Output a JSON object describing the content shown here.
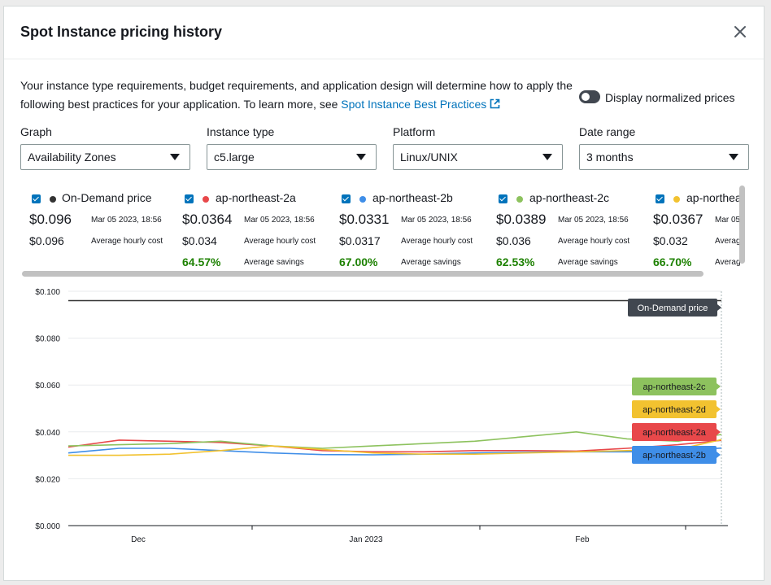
{
  "modal": {
    "title": "Spot Instance pricing history",
    "description": "Your instance type requirements, budget requirements, and application design will determine how to apply the following best practices for your application. To learn more, see ",
    "link_text": "Spot Instance Best Practices",
    "toggle_label": "Display normalized prices"
  },
  "filters": [
    {
      "label": "Graph",
      "value": "Availability Zones"
    },
    {
      "label": "Instance type",
      "value": "c5.large"
    },
    {
      "label": "Platform",
      "value": "Linux/UNIX"
    },
    {
      "label": "Date range",
      "value": "3 months"
    }
  ],
  "legend": [
    {
      "name": "On-Demand price",
      "color": "#333333",
      "price": "$0.096",
      "timestamp": "Mar 05 2023, 18:56",
      "avg_price": "$0.096",
      "avg_label": "Average hourly cost",
      "saving": "",
      "saving_label": ""
    },
    {
      "name": "ap-northeast-2a",
      "color": "#e8484a",
      "price": "$0.0364",
      "timestamp": "Mar 05 2023, 18:56",
      "avg_price": "$0.034",
      "avg_label": "Average hourly cost",
      "saving": "64.57%",
      "saving_label": "Average savings"
    },
    {
      "name": "ap-northeast-2b",
      "color": "#3f8ee8",
      "price": "$0.0331",
      "timestamp": "Mar 05 2023, 18:56",
      "avg_price": "$0.0317",
      "avg_label": "Average hourly cost",
      "saving": "67.00%",
      "saving_label": "Average savings"
    },
    {
      "name": "ap-northeast-2c",
      "color": "#8dc25e",
      "price": "$0.0389",
      "timestamp": "Mar 05 2023, 18:56",
      "avg_price": "$0.036",
      "avg_label": "Average hourly cost",
      "saving": "62.53%",
      "saving_label": "Average savings"
    },
    {
      "name": "ap-northea",
      "color": "#f2c230",
      "price": "$0.0367",
      "timestamp": "Mar 05",
      "avg_price": "$0.032",
      "avg_label": "Averag",
      "saving": "66.70%",
      "saving_label": "Averag"
    }
  ],
  "chart_data": {
    "type": "line",
    "title": "",
    "xlabel": "",
    "ylabel": "",
    "ylim": [
      0,
      0.1
    ],
    "y_ticks": [
      "$0.100",
      "$0.080",
      "$0.060",
      "$0.040",
      "$0.020",
      "$0.000"
    ],
    "x_ticks": [
      "Dec",
      "Jan 2023",
      "Feb"
    ],
    "x_range": [
      "2022-12-05",
      "2023-03-05"
    ],
    "grid": true,
    "series": [
      {
        "name": "On-Demand price",
        "color": "#333333",
        "x": [
          "2022-12-05",
          "2023-03-05"
        ],
        "values": [
          0.096,
          0.096
        ]
      },
      {
        "name": "ap-northeast-2a",
        "color": "#e8484a",
        "x": [
          "2022-12-05",
          "2022-12-12",
          "2022-12-19",
          "2022-12-26",
          "2023-01-02",
          "2023-01-09",
          "2023-01-16",
          "2023-01-23",
          "2023-01-30",
          "2023-02-06",
          "2023-02-13",
          "2023-02-20",
          "2023-02-27",
          "2023-03-05"
        ],
        "values": [
          0.0335,
          0.0365,
          0.036,
          0.0355,
          0.034,
          0.032,
          0.0315,
          0.0315,
          0.032,
          0.032,
          0.0318,
          0.033,
          0.0345,
          0.0364
        ]
      },
      {
        "name": "ap-northeast-2b",
        "color": "#3f8ee8",
        "x": [
          "2022-12-05",
          "2022-12-12",
          "2022-12-19",
          "2022-12-26",
          "2023-01-02",
          "2023-01-09",
          "2023-01-16",
          "2023-01-23",
          "2023-01-30",
          "2023-02-06",
          "2023-02-13",
          "2023-02-20",
          "2023-02-27",
          "2023-03-05"
        ],
        "values": [
          0.031,
          0.033,
          0.033,
          0.032,
          0.031,
          0.0303,
          0.0302,
          0.0305,
          0.031,
          0.0313,
          0.0315,
          0.0315,
          0.0318,
          0.0331
        ]
      },
      {
        "name": "ap-northeast-2c",
        "color": "#8dc25e",
        "x": [
          "2022-12-05",
          "2022-12-12",
          "2022-12-19",
          "2022-12-26",
          "2023-01-02",
          "2023-01-09",
          "2023-01-16",
          "2023-01-23",
          "2023-01-30",
          "2023-02-06",
          "2023-02-13",
          "2023-02-20",
          "2023-02-27",
          "2023-03-05"
        ],
        "values": [
          0.034,
          0.0345,
          0.035,
          0.036,
          0.034,
          0.033,
          0.034,
          0.035,
          0.036,
          0.038,
          0.04,
          0.037,
          0.036,
          0.0389
        ]
      },
      {
        "name": "ap-northeast-2d",
        "color": "#f2c230",
        "x": [
          "2022-12-05",
          "2022-12-12",
          "2022-12-19",
          "2022-12-26",
          "2023-01-02",
          "2023-01-09",
          "2023-01-16",
          "2023-01-23",
          "2023-01-30",
          "2023-02-06",
          "2023-02-13",
          "2023-02-20",
          "2023-02-27",
          "2023-03-05"
        ],
        "values": [
          0.03,
          0.03,
          0.0305,
          0.032,
          0.034,
          0.0325,
          0.031,
          0.0305,
          0.0305,
          0.031,
          0.0315,
          0.032,
          0.0325,
          0.0367
        ]
      }
    ],
    "end_labels": [
      "On-Demand price",
      "ap-northeast-2c",
      "ap-northeast-2d",
      "ap-northeast-2a",
      "ap-northeast-2b"
    ]
  }
}
